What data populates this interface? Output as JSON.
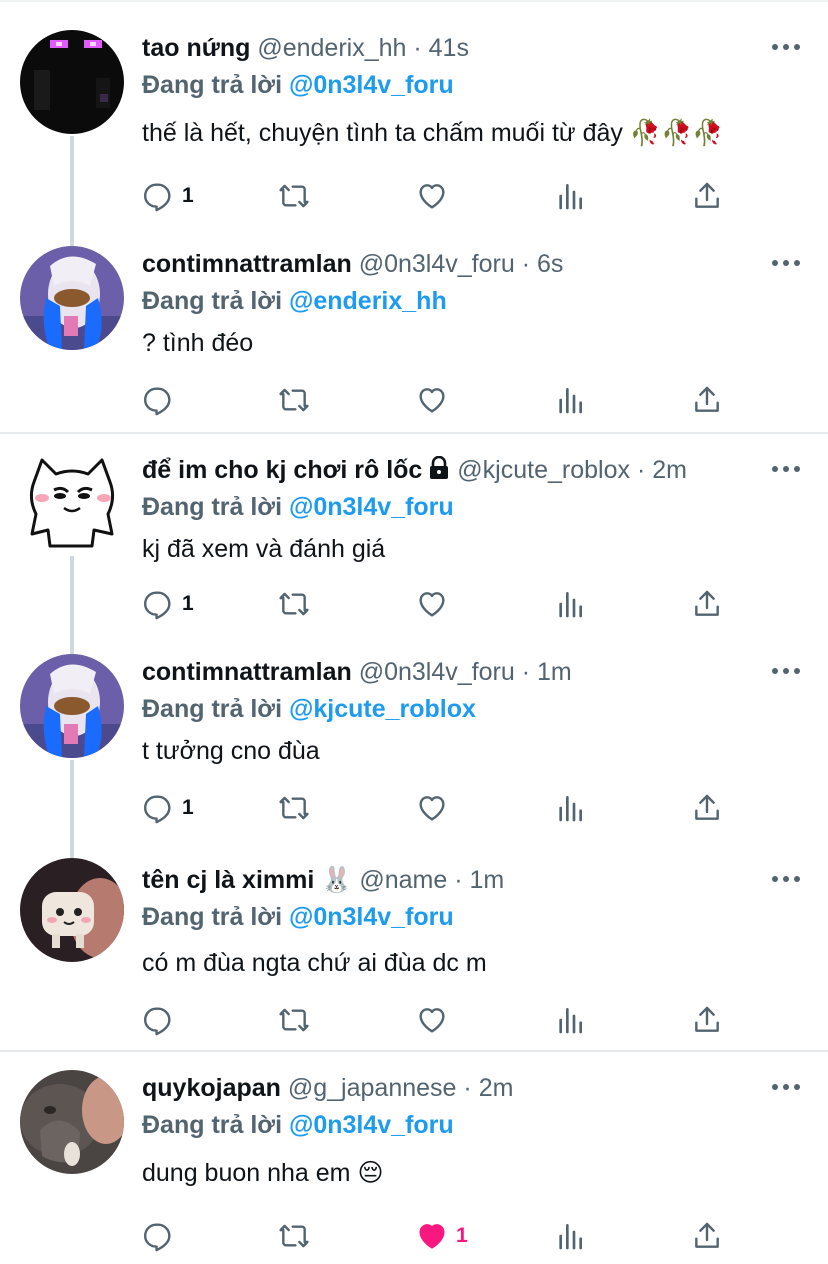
{
  "tweets": [
    {
      "name": "tao nứng",
      "handle": "@enderix_hh",
      "time": "41s",
      "replying_prefix": "Đang trả lời",
      "replying_to": "@0n3l4v_foru",
      "text": "thế là hết, chuyện tình ta chấm muối từ đây 🥀🥀🥀",
      "reply_count": "1",
      "like_count": ""
    },
    {
      "name": "contimnattramlan",
      "handle": "@0n3l4v_foru",
      "time": "6s",
      "replying_prefix": "Đang trả lời",
      "replying_to": "@enderix_hh",
      "text": "? tình đéo",
      "reply_count": "",
      "like_count": ""
    },
    {
      "name": "để im cho kj chơi rô lốc",
      "handle": "@kjcute_roblox",
      "time": "2m",
      "replying_prefix": "Đang trả lời",
      "replying_to": "@0n3l4v_foru",
      "text": "kj đã xem và đánh giá",
      "reply_count": "1",
      "like_count": ""
    },
    {
      "name": "contimnattramlan",
      "handle": "@0n3l4v_foru",
      "time": "1m",
      "replying_prefix": "Đang trả lời",
      "replying_to": "@kjcute_roblox",
      "text": "t tưởng cno đùa",
      "reply_count": "1",
      "like_count": ""
    },
    {
      "name": "tên cj là ximmi 🐰",
      "handle": "@name",
      "time": "1m",
      "replying_prefix": "Đang trả lời",
      "replying_to": "@0n3l4v_foru",
      "text": "có m đùa ngta chứ ai đùa dc m",
      "reply_count": "",
      "like_count": ""
    },
    {
      "name": "quykojapan",
      "handle": "@g_japannese",
      "time": "2m",
      "replying_prefix": "Đang trả lời",
      "replying_to": "@0n3l4v_foru",
      "text": "dung buon nha em 😔",
      "reply_count": "",
      "like_count": "1"
    }
  ],
  "separator": "·",
  "icons": {
    "reply": "reply-icon",
    "retweet": "retweet-icon",
    "like": "heart-icon",
    "views": "analytics-icon",
    "share": "share-icon",
    "more": "more-icon",
    "lock": "lock-icon"
  },
  "colors": {
    "mention": "#1d9bf0",
    "secondary": "#536471",
    "like_active": "#f91880",
    "thread_line": "#cfd9de"
  }
}
